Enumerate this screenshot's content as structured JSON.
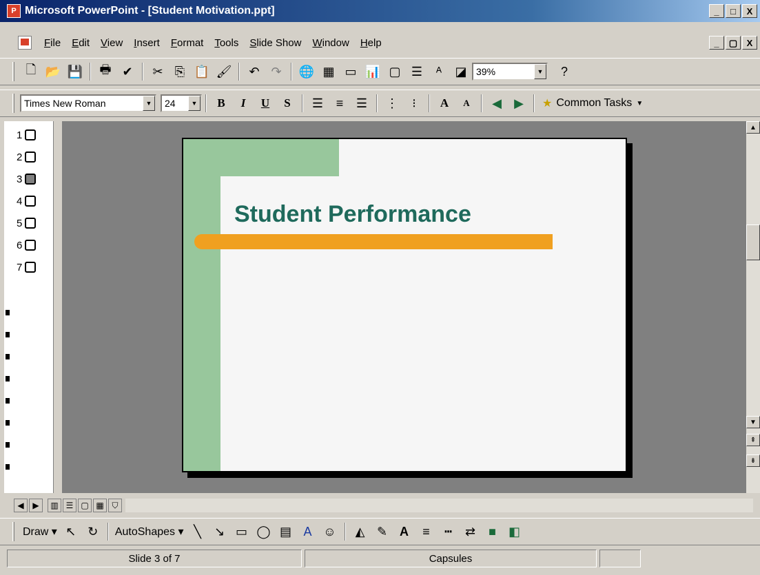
{
  "window": {
    "title": "Microsoft PowerPoint - [Student Motivation.ppt]",
    "app_icon": "powerpoint-icon",
    "controls": [
      "_",
      "□",
      "X"
    ]
  },
  "menubar": {
    "items": [
      "File",
      "Edit",
      "View",
      "Insert",
      "Format",
      "Tools",
      "Slide Show",
      "Window",
      "Help"
    ],
    "doc_controls": [
      "_",
      "▢",
      "X"
    ]
  },
  "standard_toolbar": {
    "zoom": "39%"
  },
  "formatting_toolbar": {
    "font": "Times New Roman",
    "size": "24",
    "common_tasks": "Common Tasks"
  },
  "slides_pane": {
    "numbers": [
      "1",
      "2",
      "3",
      "4",
      "5",
      "6",
      "7"
    ],
    "active_index": 2
  },
  "slide": {
    "title": "Student Performance",
    "colors": {
      "green": "#98c79c",
      "orange": "#f0a020",
      "title": "#1f6a5c"
    }
  },
  "drawing_toolbar": {
    "draw": "Draw",
    "autoshapes": "AutoShapes"
  },
  "statusbar": {
    "slide": "Slide 3 of 7",
    "design": "Capsules"
  }
}
